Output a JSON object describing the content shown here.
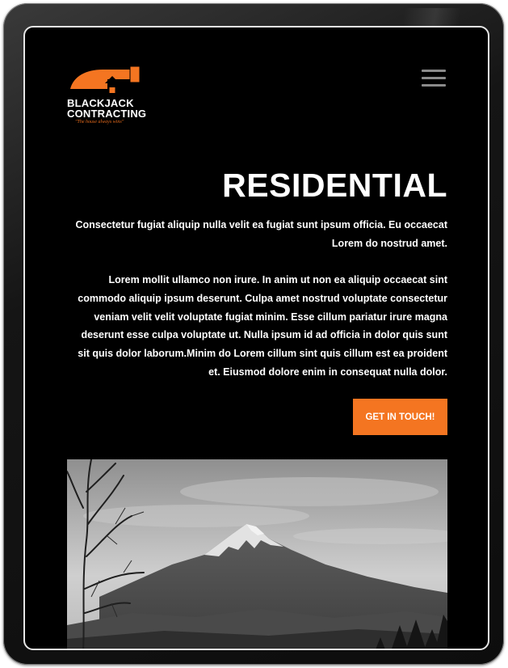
{
  "logo": {
    "line1": "BLACKJACK",
    "line2": "CONTRACTING",
    "tagline": "\"The house always wins\"",
    "icon": "hammer-house-icon",
    "accent_color": "#f47521"
  },
  "header": {
    "menu_icon": "hamburger-menu-icon"
  },
  "main": {
    "title": "RESIDENTIAL",
    "lead": "Consectetur fugiat aliquip nulla velit ea fugiat sunt ipsum officia. Eu occaecat Lorem do nostrud amet.",
    "body": "Lorem mollit ullamco non irure. In anim ut non ea aliquip occaecat sint commodo aliquip ipsum deserunt. Culpa amet nostrud voluptate consectetur veniam velit velit voluptate fugiat minim. Esse cillum pariatur irure magna deserunt esse culpa voluptate ut. Nulla ipsum id ad officia in dolor quis sunt sit quis dolor laborum.Minim do Lorem cillum sint quis cillum est ea proident et. Eiusmod dolore enim in consequat nulla dolor.",
    "cta_label": "GET IN TOUCH!",
    "cta_color": "#f47521"
  },
  "hero_image": {
    "subject": "mountain-landscape-image"
  }
}
